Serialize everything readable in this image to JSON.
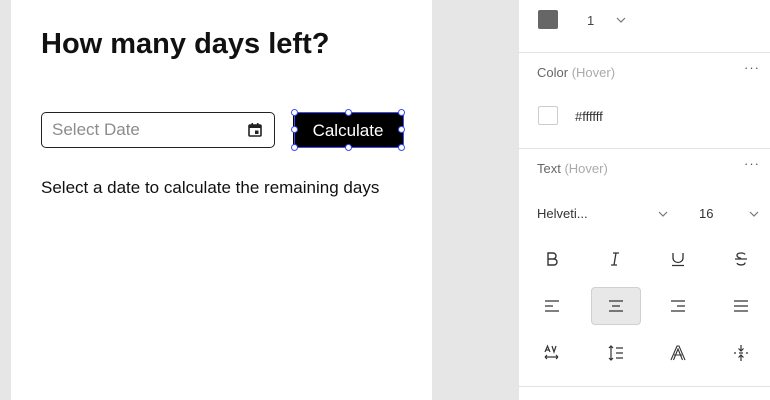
{
  "canvas": {
    "title": "How many days left?",
    "date_input": {
      "placeholder": "Select Date",
      "value": ""
    },
    "calculate_label": "Calculate",
    "status": "Select a date to calculate the remaining days"
  },
  "panel": {
    "border": {
      "width_value": "1",
      "swatch_color": "#666666"
    },
    "color_section": {
      "title": "Color",
      "state": "(Hover)",
      "hex": "#ffffff",
      "more": "···"
    },
    "text_section": {
      "title": "Text",
      "state": "(Hover)",
      "more": "···",
      "font": "Helveti...",
      "size": "16"
    },
    "style_buttons": [
      "bold-icon",
      "italic-icon",
      "underline-icon",
      "strikethrough-icon"
    ],
    "align_buttons": [
      "align-left-icon",
      "align-center-icon",
      "align-right-icon",
      "align-justify-icon"
    ],
    "align_selected": "center",
    "extra_buttons": [
      "letter-spacing-icon",
      "line-height-icon",
      "text-outline-icon",
      "vertical-align-icon"
    ]
  },
  "colors": {
    "selection": "#3b4ef5",
    "button_bg": "#000000",
    "active_tool_bg": "#e8e8e8"
  }
}
